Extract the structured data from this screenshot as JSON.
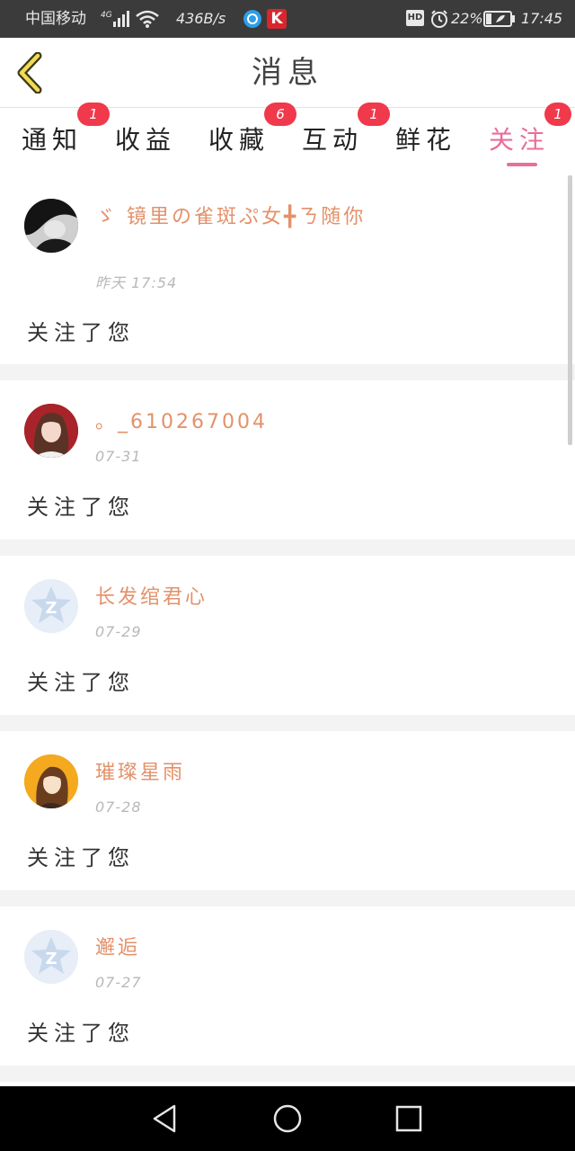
{
  "status_bar": {
    "carrier": "中国移动",
    "network": "4G",
    "speed": "436B/s",
    "battery_percent": "22%",
    "time": "17:45",
    "hd_label": "HD",
    "k_label": "K"
  },
  "header": {
    "title": "消息"
  },
  "tabs": [
    {
      "label": "通知",
      "badge": "1"
    },
    {
      "label": "收益",
      "badge": ""
    },
    {
      "label": "收藏",
      "badge": "6"
    },
    {
      "label": "互动",
      "badge": "1"
    },
    {
      "label": "鲜花",
      "badge": ""
    },
    {
      "label": "关注",
      "badge": "1",
      "active": true
    }
  ],
  "items": [
    {
      "username": "ゞ 镜里の雀斑ぷ女╋ㄋ随你",
      "time": "昨天 17:54",
      "message": "关注了您",
      "avatar": "photo-dark"
    },
    {
      "username": "。_610267004",
      "time": "07-31",
      "message": "关注了您",
      "avatar": "photo-girl"
    },
    {
      "username": "长发绾君心",
      "time": "07-29",
      "message": "关注了您",
      "avatar": "default-star"
    },
    {
      "username": "璀璨星雨",
      "time": "07-28",
      "message": "关注了您",
      "avatar": "anime-girl"
    },
    {
      "username": "邂逅",
      "time": "07-27",
      "message": "关注了您",
      "avatar": "default-star"
    }
  ],
  "colors": {
    "accent": "#e86f9b",
    "username": "#e3916a",
    "badge": "#f0394b",
    "status_bar": "#3b3b3b"
  }
}
